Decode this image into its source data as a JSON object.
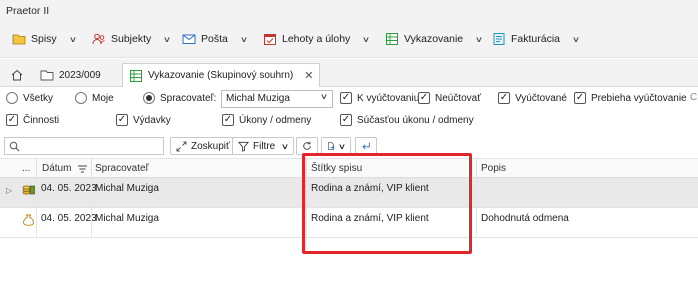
{
  "app": {
    "title": "Praetor II"
  },
  "menu": [
    {
      "label": "Spisy",
      "icon": "folder-icon"
    },
    {
      "label": "Subjekty",
      "icon": "people-icon"
    },
    {
      "label": "Pošta",
      "icon": "mail-icon"
    },
    {
      "label": "Lehoty a úlohy",
      "icon": "calendar-icon"
    },
    {
      "label": "Vykazovanie",
      "icon": "spreadsheet-icon"
    },
    {
      "label": "Fakturácia",
      "icon": "invoice-icon"
    }
  ],
  "tabs": [
    {
      "label": "",
      "icon": "home-icon"
    },
    {
      "label": "2023/009",
      "icon": "folder-icon"
    },
    {
      "label": "Vykazovanie (Skupinový souhrn)",
      "icon": "spreadsheet-icon",
      "active": true
    }
  ],
  "filters": {
    "radios": [
      {
        "label": "Všetky",
        "checked": false
      },
      {
        "label": "Moje",
        "checked": false
      },
      {
        "label": "Spracovateľ:",
        "checked": true
      }
    ],
    "processor_value": "Michal Muziga",
    "state_checks": [
      {
        "label": "K vyúčtovaniu",
        "checked": true
      },
      {
        "label": "Neúčtovať",
        "checked": true
      },
      {
        "label": "Vyúčtované",
        "checked": true
      },
      {
        "label": "Prebieha vyúčtovanie",
        "checked": true
      },
      {
        "label": "C",
        "checked": false
      }
    ],
    "type_checks": [
      {
        "label": "Činnosti",
        "checked": true
      },
      {
        "label": "Výdavky",
        "checked": true
      },
      {
        "label": "Úkony / odmeny",
        "checked": true
      },
      {
        "label": "Súčasťou úkonu / odmeny",
        "checked": true
      }
    ]
  },
  "toolbar": {
    "search_value": "",
    "group_label": "Zoskupiť",
    "filter_label": "Filtre"
  },
  "grid": {
    "columns": [
      "...",
      "Dátum",
      "Spracovateľ",
      "Štítky spisu",
      "Popis"
    ],
    "rows": [
      {
        "date": "04. 05. 2023",
        "processor": "Michal Muziga",
        "tags": "Rodina a známí, VIP klient",
        "description": "",
        "icon": "coins-icon",
        "expandable": true
      },
      {
        "date": "04. 05. 2023",
        "processor": "Michal Muziga",
        "tags": "Rodina a známí, VIP klient",
        "description": "Dohodnutá odmena",
        "icon": "money-bag-icon",
        "expandable": false
      }
    ]
  },
  "colors": {
    "accent_green": "#2e9e3e",
    "highlight_red": "#e3262b",
    "selected_row": "#e9e9e9"
  }
}
